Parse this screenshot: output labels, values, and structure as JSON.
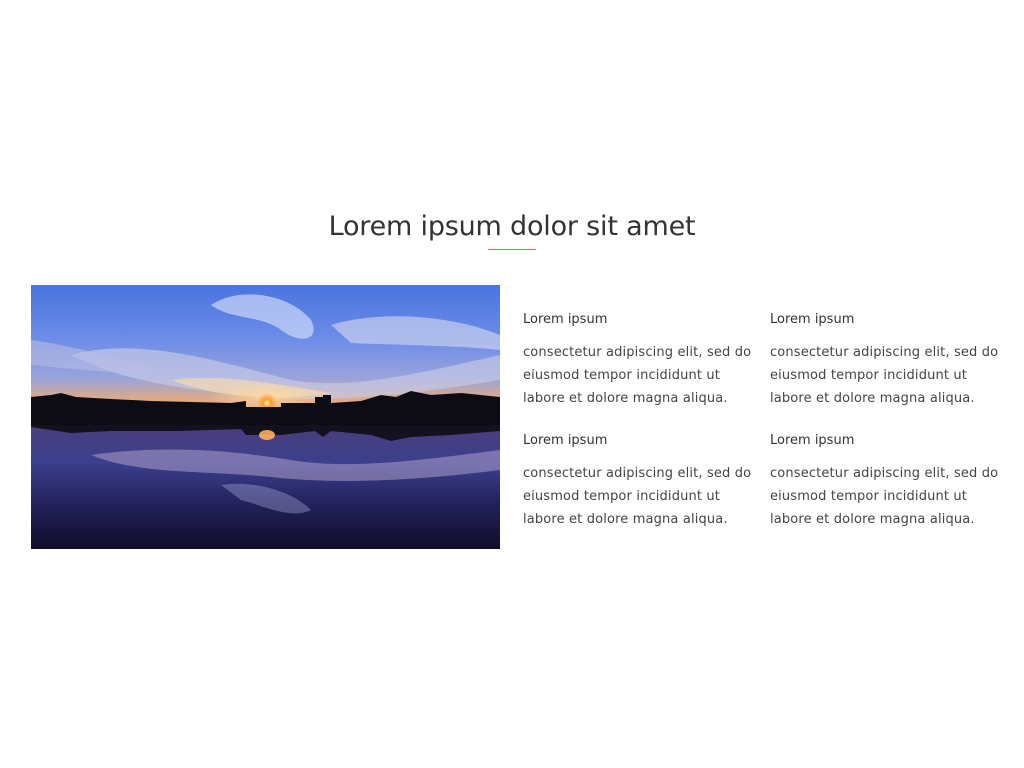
{
  "header": {
    "title": "Lorem ipsum dolor sit amet"
  },
  "features": [
    {
      "title": "Lorem ipsum",
      "text": "consectetur adipiscing elit, sed do eiusmod tempor incididunt ut labore et dolore magna aliqua."
    },
    {
      "title": "Lorem ipsum",
      "text": "consectetur adipiscing elit, sed do eiusmod tempor incididunt ut labore et dolore magna aliqua."
    },
    {
      "title": "Lorem ipsum",
      "text": "consectetur adipiscing elit, sed do eiusmod tempor incididunt ut labore et dolore magna aliqua."
    },
    {
      "title": "Lorem ipsum",
      "text": "consectetur adipiscing elit, sed do eiusmod tempor incididunt ut labore et dolore magna aliqua."
    }
  ],
  "colors": {
    "accent": "#e06a60",
    "text": "#333333",
    "background": "#ffffff"
  }
}
